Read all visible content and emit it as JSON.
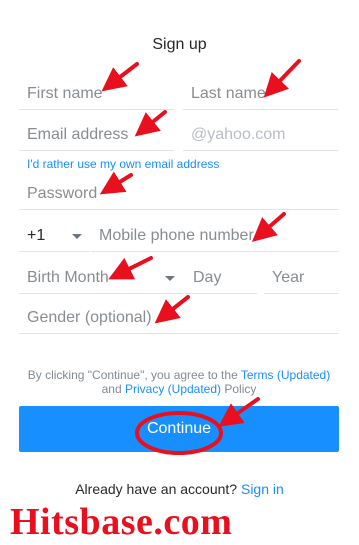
{
  "page": {
    "title": "Sign up"
  },
  "form": {
    "first_name_placeholder": "First name",
    "last_name_placeholder": "Last name",
    "email_placeholder": "Email address",
    "email_domain": "@yahoo.com",
    "own_email_link": "I'd rather use my own email address",
    "password_placeholder": "Password",
    "country_code": "+1",
    "phone_placeholder": "Mobile phone number",
    "birth_month_placeholder": "Birth Month",
    "day_placeholder": "Day",
    "year_placeholder": "Year",
    "gender_placeholder": "Gender (optional)"
  },
  "terms": {
    "prefix": "By clicking \"Continue\", you agree to the ",
    "terms_link": "Terms (Updated)",
    "and": "and ",
    "privacy_link": "Privacy (Updated)",
    "suffix": " Policy"
  },
  "continue_label": "Continue",
  "signin": {
    "prompt": "Already have an account? ",
    "link": "Sign in"
  },
  "watermark": "Hitsbase.com",
  "colors": {
    "accent": "#188fff",
    "annotation": "#e8101e",
    "watermark": "#e8101e"
  }
}
